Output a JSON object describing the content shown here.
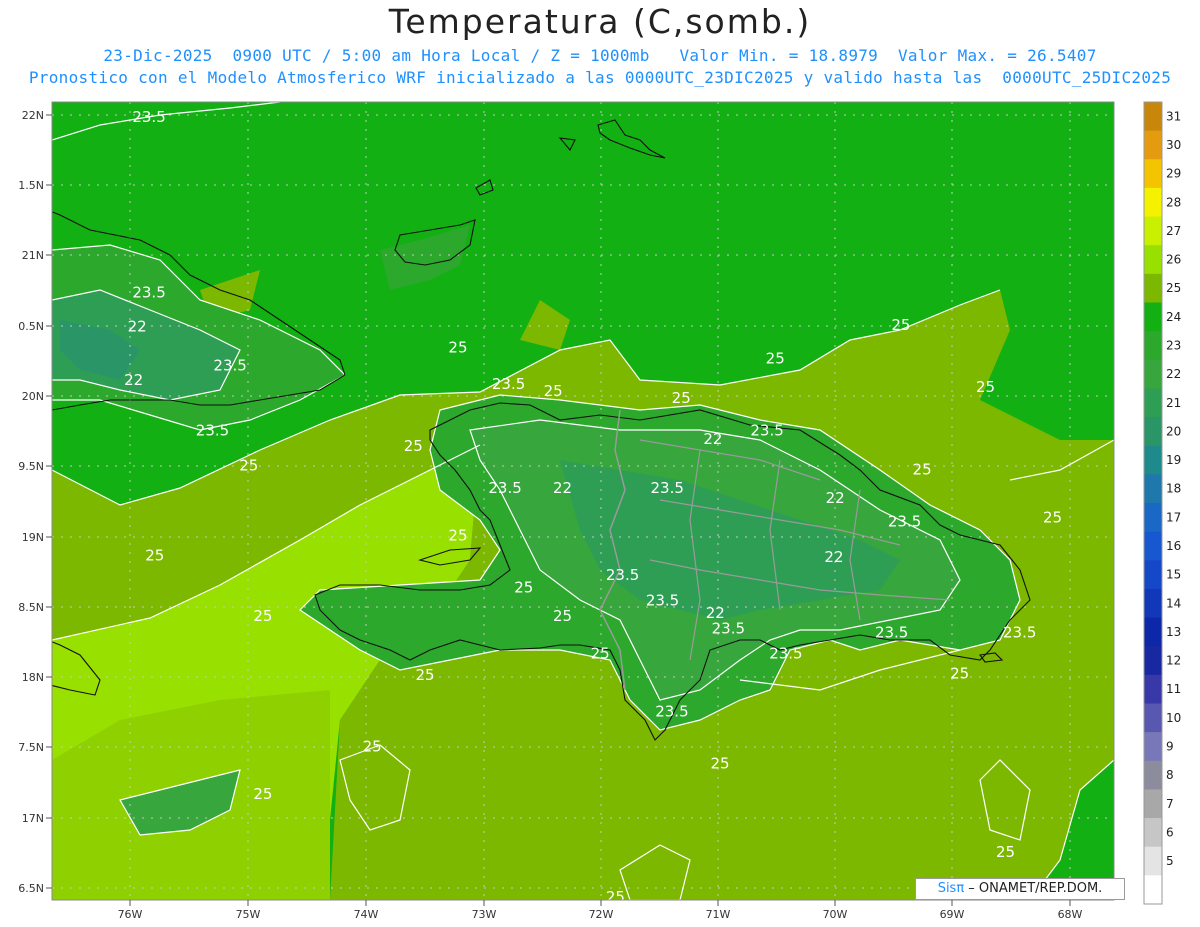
{
  "title": "Temperatura (C,somb.)",
  "subtitle_line1": "23-Dic-2025  0900 UTC / 5:00 am Hora Local / Z = 1000mb   Valor Min. = 18.8979  Valor Max. = 26.5407",
  "subtitle_line2": "Pronostico con el Modelo Atmosferico WRF inicializado a las 0000UTC_23DIC2025 y valido hasta las  0000UTC_25DIC2025",
  "latitude_ticks": [
    "22N",
    "1.5N",
    "21N",
    "0.5N",
    "20N",
    "9.5N",
    "19N",
    "8.5N",
    "18N",
    "7.5N",
    "17N",
    "6.5N"
  ],
  "longitude_ticks": [
    "76W",
    "75W",
    "74W",
    "73W",
    "72W",
    "71W",
    "70W",
    "69W",
    "68W"
  ],
  "contour_labels": [
    {
      "text": "23.5",
      "lon": -75.98,
      "lat": 21.95
    },
    {
      "text": "23.5",
      "lon": -75.98,
      "lat": 20.7
    },
    {
      "text": "22",
      "lon": -76.02,
      "lat": 20.46
    },
    {
      "text": "22",
      "lon": -76.05,
      "lat": 20.08
    },
    {
      "text": "23.5",
      "lon": -75.29,
      "lat": 20.18
    },
    {
      "text": "23.5",
      "lon": -75.44,
      "lat": 19.72
    },
    {
      "text": "25",
      "lon": -75.07,
      "lat": 19.47
    },
    {
      "text": "25",
      "lon": -73.67,
      "lat": 19.61
    },
    {
      "text": "25",
      "lon": -73.29,
      "lat": 20.31
    },
    {
      "text": "23.5",
      "lon": -72.92,
      "lat": 20.05
    },
    {
      "text": "25",
      "lon": -72.48,
      "lat": 20.0
    },
    {
      "text": "25",
      "lon": -71.39,
      "lat": 19.95
    },
    {
      "text": "22",
      "lon": -71.12,
      "lat": 19.66
    },
    {
      "text": "23.5",
      "lon": -70.72,
      "lat": 19.72
    },
    {
      "text": "25",
      "lon": -70.59,
      "lat": 20.23
    },
    {
      "text": "25",
      "lon": -69.52,
      "lat": 20.47
    },
    {
      "text": "25",
      "lon": -68.8,
      "lat": 20.03
    },
    {
      "text": "25",
      "lon": -69.34,
      "lat": 19.44
    },
    {
      "text": "23.5",
      "lon": -72.95,
      "lat": 19.31
    },
    {
      "text": "22",
      "lon": -72.4,
      "lat": 19.31
    },
    {
      "text": "23.5",
      "lon": -71.57,
      "lat": 19.31
    },
    {
      "text": "22",
      "lon": -70.08,
      "lat": 19.24
    },
    {
      "text": "23.5",
      "lon": -69.55,
      "lat": 19.07
    },
    {
      "text": "25",
      "lon": -68.23,
      "lat": 19.1
    },
    {
      "text": "22",
      "lon": -70.09,
      "lat": 18.82
    },
    {
      "text": "25",
      "lon": -73.29,
      "lat": 18.97
    },
    {
      "text": "25",
      "lon": -75.87,
      "lat": 18.83
    },
    {
      "text": "23.5",
      "lon": -71.95,
      "lat": 18.69
    },
    {
      "text": "25",
      "lon": -72.73,
      "lat": 18.6
    },
    {
      "text": "23.5",
      "lon": -71.61,
      "lat": 18.51
    },
    {
      "text": "22",
      "lon": -71.1,
      "lat": 18.42
    },
    {
      "text": "23.5",
      "lon": -71.05,
      "lat": 18.31
    },
    {
      "text": "25",
      "lon": -74.95,
      "lat": 18.4
    },
    {
      "text": "25",
      "lon": -72.4,
      "lat": 18.4
    },
    {
      "text": "23.5",
      "lon": -69.66,
      "lat": 18.28
    },
    {
      "text": "23.5",
      "lon": -68.57,
      "lat": 18.28
    },
    {
      "text": "25",
      "lon": -72.08,
      "lat": 18.13
    },
    {
      "text": "23.5",
      "lon": -70.56,
      "lat": 18.13
    },
    {
      "text": "25",
      "lon": -73.57,
      "lat": 17.98
    },
    {
      "text": "25",
      "lon": -69.02,
      "lat": 17.99
    },
    {
      "text": "23.5",
      "lon": -71.53,
      "lat": 17.72
    },
    {
      "text": "25",
      "lon": -74.02,
      "lat": 17.47
    },
    {
      "text": "25",
      "lon": -71.06,
      "lat": 17.35
    },
    {
      "text": "25",
      "lon": -74.95,
      "lat": 17.13
    },
    {
      "text": "25",
      "lon": -68.63,
      "lat": 16.72
    },
    {
      "text": "25",
      "lon": -71.95,
      "lat": 16.4
    }
  ],
  "colorbar": {
    "labels": [
      "31",
      "30",
      "29",
      "28",
      "27",
      "26",
      "25",
      "24",
      "23",
      "22",
      "21",
      "20",
      "19",
      "18",
      "17",
      "16",
      "15",
      "14",
      "13",
      "12",
      "11",
      "10",
      "9",
      "8",
      "7",
      "6",
      "5"
    ],
    "colors": [
      "#c8860a",
      "#e49b0f",
      "#f5c400",
      "#f5f200",
      "#c8f000",
      "#98e000",
      "#7cb800",
      "#12b012",
      "#2ca82c",
      "#36a63d",
      "#2e9e55",
      "#2a9668",
      "#1f8a8c",
      "#1f78ac",
      "#1a68c6",
      "#1758d0",
      "#1448c8",
      "#1038b8",
      "#0c28a8",
      "#1828a0",
      "#3838a8",
      "#5858b0",
      "#7878b8",
      "#8c8c9c",
      "#a8a8a8",
      "#c6c6c6",
      "#e4e4e4",
      "#ffffff"
    ]
  },
  "credit": {
    "brand": "Sisπ",
    "text": " – ONAMET/REP.DOM."
  }
}
